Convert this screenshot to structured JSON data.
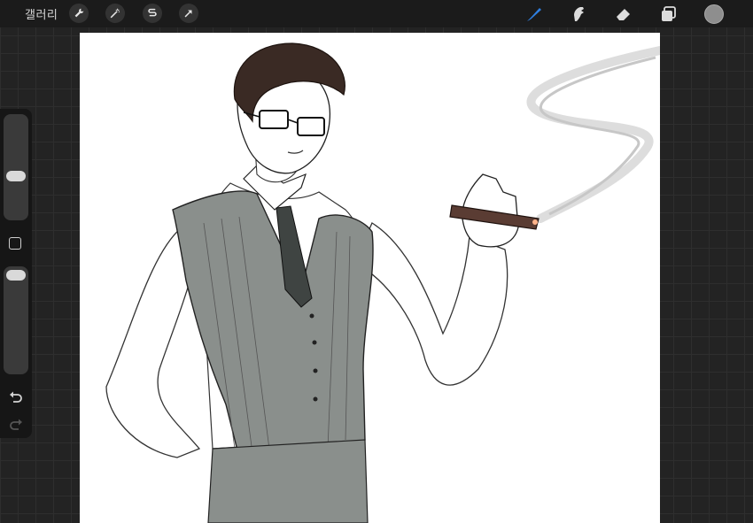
{
  "topbar": {
    "gallery_label": "갤러리",
    "left_tools": [
      "wrench-icon",
      "magic-wand-icon",
      "selection-icon",
      "transform-arrow-icon"
    ],
    "right_tools": [
      "brush-icon",
      "smudge-icon",
      "eraser-icon",
      "layers-icon"
    ],
    "active_tool": "brush-icon",
    "accent_color": "#2f7fe0",
    "current_color": "#8e8e8e"
  },
  "sidebar": {
    "brush_size_level": 0.3,
    "opacity_level": 0.1,
    "tools": [
      "brush-size-slider",
      "modify-button",
      "opacity-slider",
      "undo-icon",
      "redo-icon"
    ]
  },
  "canvas": {
    "background_color": "#ffffff",
    "subject": "sketch"
  }
}
